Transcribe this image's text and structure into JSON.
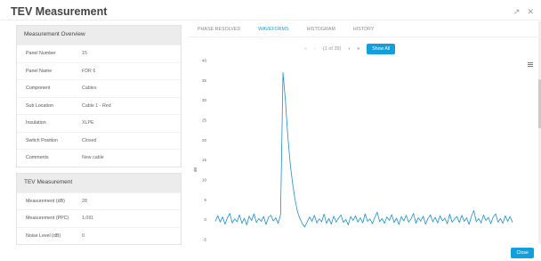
{
  "dialog": {
    "title": "TEV Measurement",
    "icons": [
      "external-link-icon",
      "close-icon"
    ],
    "close_label": "Close"
  },
  "overview": {
    "title": "Measurement Overview",
    "rows": [
      {
        "label": "Panel Number",
        "value": "15"
      },
      {
        "label": "Panel Name",
        "value": "FDR 6"
      },
      {
        "label": "Component",
        "value": "Cables"
      },
      {
        "label": "Sub Location",
        "value": "Cable 1 - Red"
      },
      {
        "label": "Insulation",
        "value": "XLPE"
      },
      {
        "label": "Switch Position",
        "value": "Closed"
      },
      {
        "label": "Comments",
        "value": "New cable"
      }
    ]
  },
  "tev": {
    "title": "TEV Measurement",
    "rows": [
      {
        "label": "Measurement (dB)",
        "value": "28"
      },
      {
        "label": "Measurement (PPC)",
        "value": "1.091"
      },
      {
        "label": "Noise Level (dB)",
        "value": "0"
      }
    ]
  },
  "tabs": [
    {
      "label": "PHASE RESOLVED",
      "active": false
    },
    {
      "label": "WAVEFORMS",
      "active": true
    },
    {
      "label": "HISTOGRAM",
      "active": false
    },
    {
      "label": "HISTORY",
      "active": false
    }
  ],
  "pager": {
    "first": "«",
    "prev": "‹",
    "status": "(1 of 39)",
    "next": "›",
    "last": "»",
    "show_all": "Show All"
  },
  "colors": {
    "accent": "#11a0dd",
    "line": "#1a8fd0"
  },
  "chart_data": {
    "type": "line",
    "ylabel": "dB",
    "ylim": [
      -5,
      40
    ],
    "yticks": [
      -5,
      0,
      5,
      10,
      15,
      20,
      25,
      30,
      35,
      40
    ],
    "ytick_labels": [
      "-5",
      "0",
      "5",
      "10",
      "15",
      "20",
      "25",
      "30",
      "35",
      "40"
    ],
    "grid": false,
    "series": [
      {
        "values": [
          -0.4,
          1.0,
          -0.6,
          0.7,
          -1.1,
          0.5,
          1.6,
          -0.8,
          0.2,
          -0.5,
          1.2,
          -0.9,
          0.4,
          -1.3,
          0.9,
          -0.2,
          1.5,
          -0.7,
          0.3,
          -0.4,
          0.8,
          -1.2,
          0.6,
          1.1,
          -0.3,
          0.5,
          -0.9,
          1.3,
          37,
          30,
          21,
          14,
          9,
          5,
          2,
          0.3,
          -1.0,
          -1.8,
          -0.6,
          0.7,
          -0.4,
          1.1,
          -0.8,
          0.2,
          -0.5,
          1.4,
          -0.9,
          0.3,
          -1.1,
          0.9,
          -0.6,
          0.4,
          1.2,
          -0.7,
          0.1,
          -1.3,
          0.8,
          -0.2,
          1.0,
          -0.6,
          0.5,
          -0.8,
          1.5,
          -0.4,
          0.2,
          -1.0,
          0.6,
          1.9,
          -0.5,
          0.3,
          -0.9,
          0.7,
          -0.2,
          1.3,
          -0.7,
          0.4,
          -1.2,
          0.8,
          -0.3,
          1.1,
          -0.6,
          0.2,
          1.6,
          -0.9,
          0.5,
          -0.4,
          0.9,
          -1.1,
          0.3,
          1.2,
          -0.5,
          0.6,
          -0.8,
          1.0,
          -0.3,
          0.4,
          -1.0,
          1.4,
          -0.6,
          0.2,
          0.8,
          -0.7,
          1.1,
          -0.4,
          0.5,
          -1.2,
          0.9,
          2.3,
          -0.5,
          0.3,
          -0.8,
          1.2,
          -0.2,
          0.6,
          -1.0,
          0.7,
          1.5,
          -0.6,
          0.3,
          -0.9,
          1.0,
          -0.4,
          0.8,
          -0.7
        ]
      }
    ]
  }
}
